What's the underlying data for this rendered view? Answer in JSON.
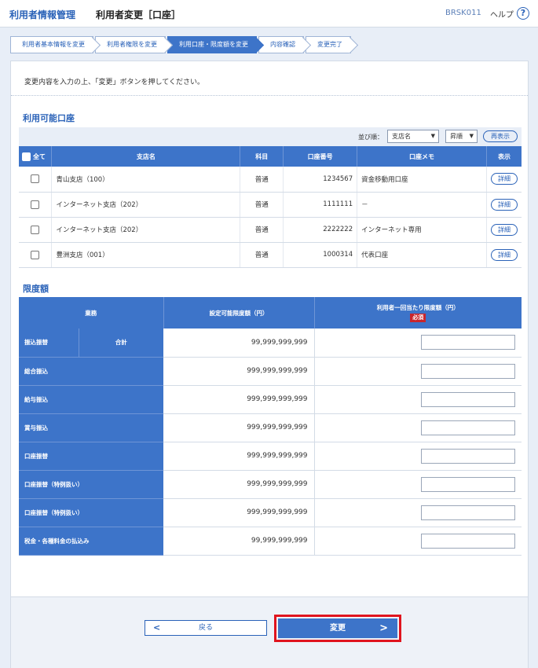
{
  "header": {
    "app_title": "利用者情報管理",
    "screen_title": "利用者変更［口座］",
    "screen_code": "BRSK011",
    "help_label": "ヘルプ",
    "help_icon": "question-circle-icon"
  },
  "steps": [
    {
      "label": "利用者基本情報を変更",
      "active": false
    },
    {
      "label": "利用者権限を変更",
      "active": false
    },
    {
      "label": "利用口座・限度額を変更",
      "active": true
    },
    {
      "label": "内容確認",
      "active": false
    },
    {
      "label": "変更完了",
      "active": false
    }
  ],
  "instruction": "変更内容を入力の上、「変更」ボタンを押してください。",
  "accounts_section": {
    "title": "利用可能口座",
    "sort_label": "並び順：",
    "sort_field": "支店名",
    "sort_order": "昇順",
    "reshow_label": "再表示",
    "columns": {
      "all": "全て",
      "branch": "支店名",
      "type": "科目",
      "number": "口座番号",
      "memo": "口座メモ",
      "show": "表示"
    },
    "detail_label": "詳細",
    "rows": [
      {
        "branch": "青山支店（100）",
        "type": "普通",
        "number": "1234567",
        "memo": "資金移動用口座"
      },
      {
        "branch": "インターネット支店（202）",
        "type": "普通",
        "number": "1111111",
        "memo": "－"
      },
      {
        "branch": "インターネット支店（202）",
        "type": "普通",
        "number": "2222222",
        "memo": "インターネット専用"
      },
      {
        "branch": "豊洲支店（001）",
        "type": "普通",
        "number": "1000314",
        "memo": "代表口座"
      }
    ]
  },
  "limits_section": {
    "title": "限度額",
    "columns": {
      "business": "業務",
      "configurable": "設定可能限度額（円）",
      "per_user": "利用者一回当たり限度額（円）",
      "required": "必須"
    },
    "rows": [
      {
        "business": "振込振替",
        "sub": "合計",
        "limit": "99,999,999,999"
      },
      {
        "business": "総合振込",
        "limit": "999,999,999,999"
      },
      {
        "business": "給与振込",
        "limit": "999,999,999,999"
      },
      {
        "business": "賞与振込",
        "limit": "999,999,999,999"
      },
      {
        "business": "口座振替",
        "limit": "999,999,999,999"
      },
      {
        "business": "口座振替（特例扱い）",
        "limit": "999,999,999,999"
      },
      {
        "business": "口座振替（特例扱い）",
        "limit": "999,999,999,999"
      },
      {
        "business": "税金・各種料金の払込み",
        "limit": "99,999,999,999"
      }
    ]
  },
  "footer": {
    "back_label": "戻る",
    "submit_label": "変更"
  },
  "colors": {
    "primary": "#3d74c9",
    "link": "#2a62b8",
    "highlight": "#e0141e",
    "required": "#c9252c"
  }
}
